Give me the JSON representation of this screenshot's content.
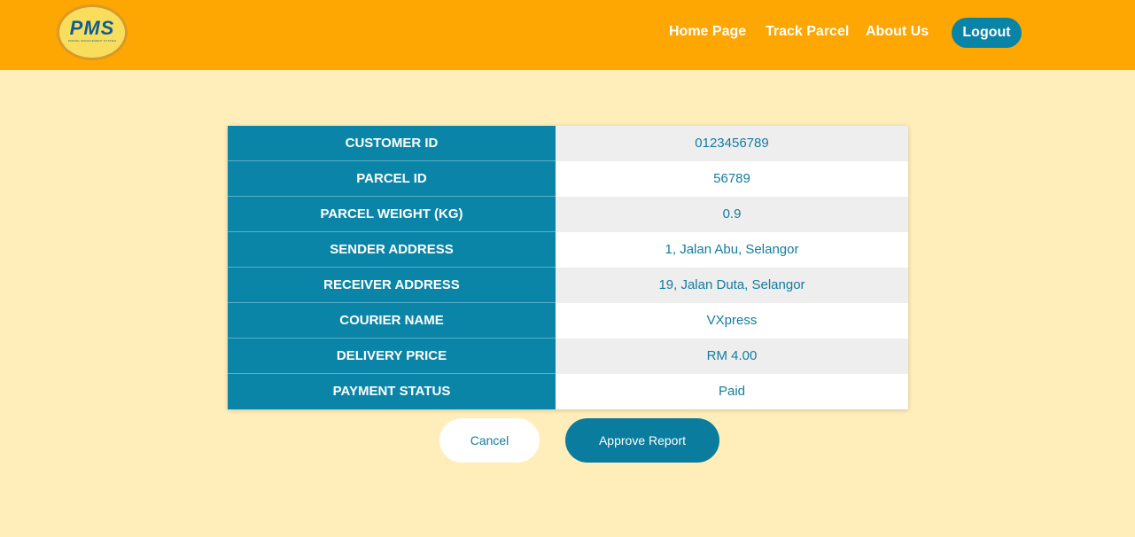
{
  "header": {
    "logo_text": "PMS",
    "logo_subtext": "PARCEL MANAGEMENT SYSTEM",
    "nav": [
      {
        "label": "Home Page"
      },
      {
        "label": "Track Parcel"
      },
      {
        "label": "About Us"
      }
    ],
    "logout_label": "Logout"
  },
  "details": {
    "rows": [
      {
        "key": "CUSTOMER ID",
        "value": "0123456789"
      },
      {
        "key": "PARCEL ID",
        "value": "56789"
      },
      {
        "key": "PARCEL WEIGHT (KG)",
        "value": "0.9"
      },
      {
        "key": "SENDER ADDRESS",
        "value": "1, Jalan Abu, Selangor"
      },
      {
        "key": "RECEIVER ADDRESS",
        "value": "19, Jalan Duta, Selangor"
      },
      {
        "key": "COURIER NAME",
        "value": "VXpress"
      },
      {
        "key": "DELIVERY PRICE",
        "value": "RM 4.00"
      },
      {
        "key": "PAYMENT STATUS",
        "value": "Paid"
      }
    ]
  },
  "actions": {
    "cancel_label": "Cancel",
    "approve_label": "Approve Report"
  }
}
